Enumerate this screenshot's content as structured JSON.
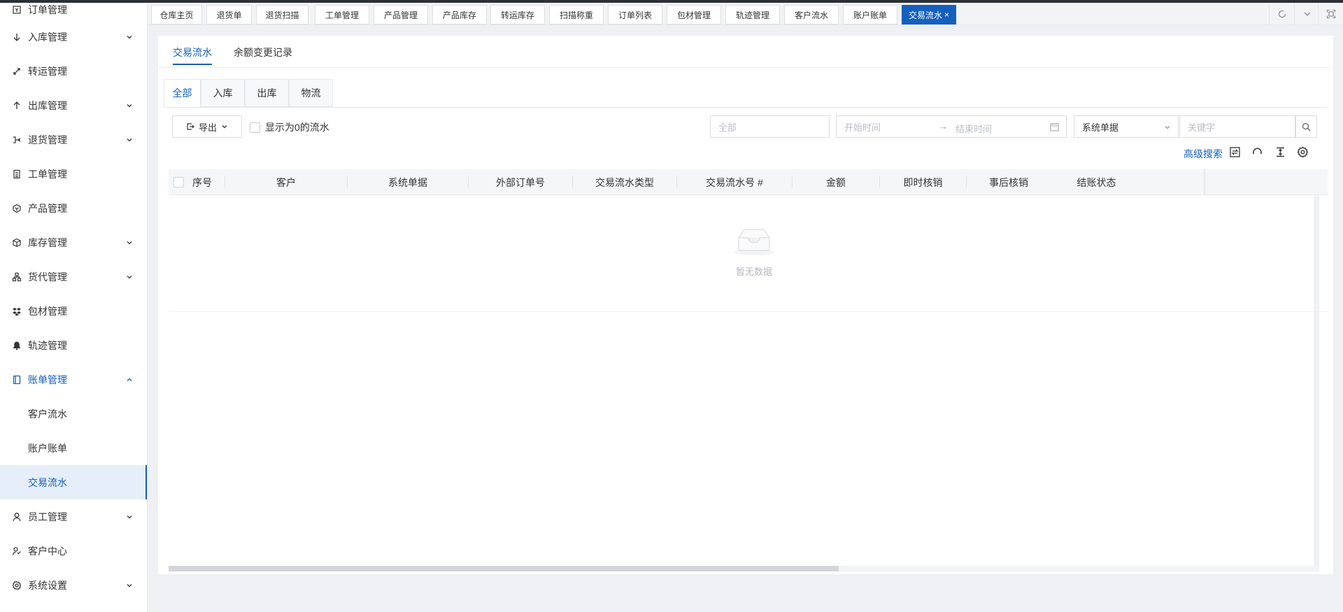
{
  "sidebar": {
    "items": [
      {
        "label": "订单管理",
        "icon": "order-icon"
      },
      {
        "label": "入库管理",
        "icon": "arrow-down-icon",
        "chevron": "down"
      },
      {
        "label": "转运管理",
        "icon": "transfer-icon"
      },
      {
        "label": "出库管理",
        "icon": "arrow-up-icon",
        "chevron": "down"
      },
      {
        "label": "退货管理",
        "icon": "return-icon",
        "chevron": "down"
      },
      {
        "label": "工单管理",
        "icon": "ticket-icon"
      },
      {
        "label": "产品管理",
        "icon": "product-icon"
      },
      {
        "label": "库存管理",
        "icon": "box-icon",
        "chevron": "down"
      },
      {
        "label": "货代管理",
        "icon": "network-icon",
        "chevron": "down"
      },
      {
        "label": "包材管理",
        "icon": "package-material-icon"
      },
      {
        "label": "轨迹管理",
        "icon": "bell-icon"
      },
      {
        "label": "账单管理",
        "icon": "bill-icon",
        "chevron": "up"
      }
    ],
    "sub_items": [
      "客户流水",
      "账户账单",
      "交易流水"
    ],
    "bottom_items": [
      {
        "label": "员工管理",
        "icon": "user-icon",
        "chevron": "down"
      },
      {
        "label": "客户中心",
        "icon": "customer-icon"
      },
      {
        "label": "系统设置",
        "icon": "gear-icon",
        "chevron": "down"
      }
    ]
  },
  "tabstrip": {
    "tabs": [
      "仓库主页",
      "退货单",
      "退货扫描",
      "工单管理",
      "产品管理",
      "产品库存",
      "转运库存",
      "扫描称重",
      "订单列表",
      "包材管理",
      "轨迹管理",
      "客户流水",
      "账户账单",
      "交易流水"
    ],
    "active_tab": "交易流水",
    "close_glyph": "×"
  },
  "page": {
    "subtabs": [
      "交易流水",
      "余额变更记录"
    ],
    "category_tabs": [
      "全部",
      "入库",
      "出库",
      "物流"
    ],
    "export_label": "导出",
    "show_zero_label": "显示为0的流水",
    "filters": {
      "type_placeholder": "全部",
      "start_placeholder": "开始时间",
      "range_arrow": "→",
      "end_placeholder": "结束时间",
      "system_select_value": "系统单据",
      "keyword_placeholder": "关键字"
    },
    "advanced_search_label": "高级搜索",
    "table": {
      "columns": [
        "序号",
        "客户",
        "系统单据",
        "外部订单号",
        "交易流水类型",
        "交易流水号 #",
        "金额",
        "即时核销",
        "事后核销",
        "结账状态"
      ],
      "empty_text": "暂无数据"
    }
  },
  "colors": {
    "accent": "#1560bd",
    "sidebar_active_bg": "#e6eef9",
    "page_bg": "#eef0f3"
  }
}
